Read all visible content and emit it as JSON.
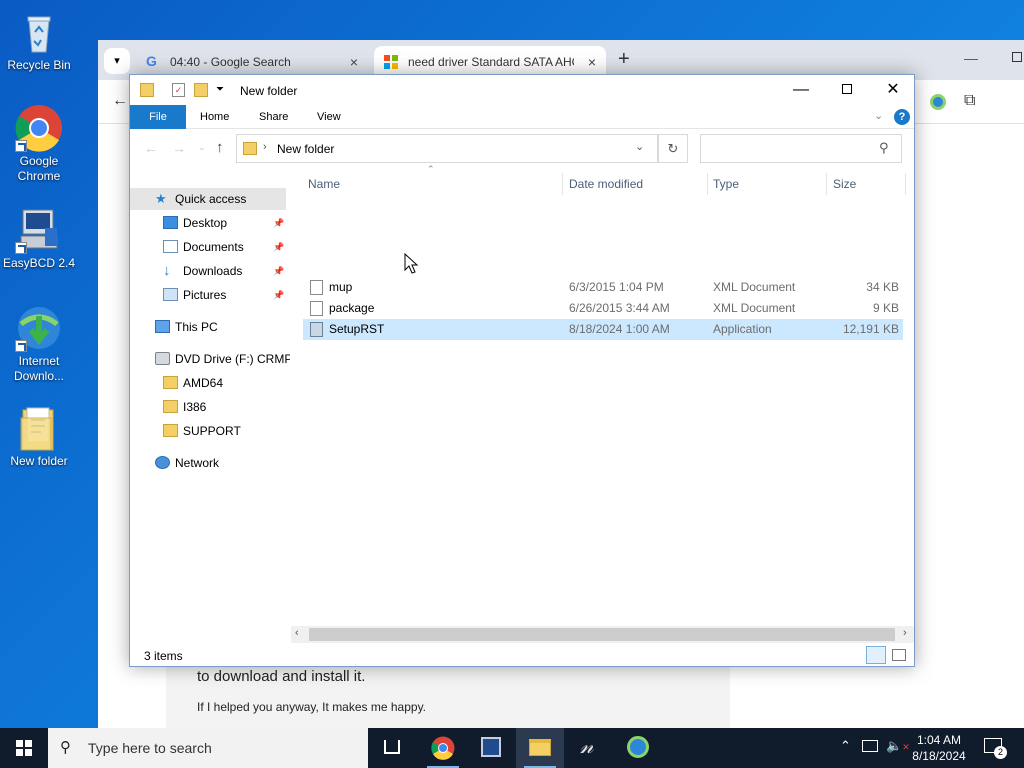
{
  "desktop": {
    "icons": [
      {
        "label": "Recycle Bin"
      },
      {
        "label": "Google Chrome"
      },
      {
        "label": "EasyBCD 2.4"
      },
      {
        "label": "Internet Downlo..."
      },
      {
        "label": "New folder"
      }
    ]
  },
  "browser": {
    "tabs": [
      {
        "title": "04:40 - Google Search",
        "icon": "google-g-icon"
      },
      {
        "title": "need driver Standard SATA AHC",
        "icon": "microsoft-logo-icon"
      }
    ],
    "page": {
      "line1": "to download and install it.",
      "line2": "If I helped you anyway, It makes me happy."
    }
  },
  "explorer": {
    "title": "New folder",
    "ribbon_tabs": [
      "File",
      "Home",
      "Share",
      "View"
    ],
    "address": {
      "path": "New folder"
    },
    "search": {
      "placeholder": ""
    },
    "nav": {
      "quick_access": "Quick access",
      "pinned": [
        "Desktop",
        "Documents",
        "Downloads",
        "Pictures"
      ],
      "this_pc": "This PC",
      "dvd": "DVD Drive (F:) CRMP",
      "dvd_children": [
        "AMD64",
        "I386",
        "SUPPORT"
      ],
      "network": "Network"
    },
    "columns": [
      "Name",
      "Date modified",
      "Type",
      "Size"
    ],
    "files": [
      {
        "name": "mup",
        "date": "6/3/2015 1:04 PM",
        "type": "XML Document",
        "size": "34 KB",
        "icon": "xml-document-icon"
      },
      {
        "name": "package",
        "date": "6/26/2015 3:44 AM",
        "type": "XML Document",
        "size": "9 KB",
        "icon": "xml-document-icon"
      },
      {
        "name": "SetupRST",
        "date": "8/18/2024 1:00 AM",
        "type": "Application",
        "size": "12,191 KB",
        "icon": "setup-application-icon",
        "selected": true
      }
    ],
    "status": "3 items"
  },
  "taskbar": {
    "search_placeholder": "Type here to search",
    "time": "1:04 AM",
    "date": "8/18/2024",
    "notification_count": "2"
  }
}
